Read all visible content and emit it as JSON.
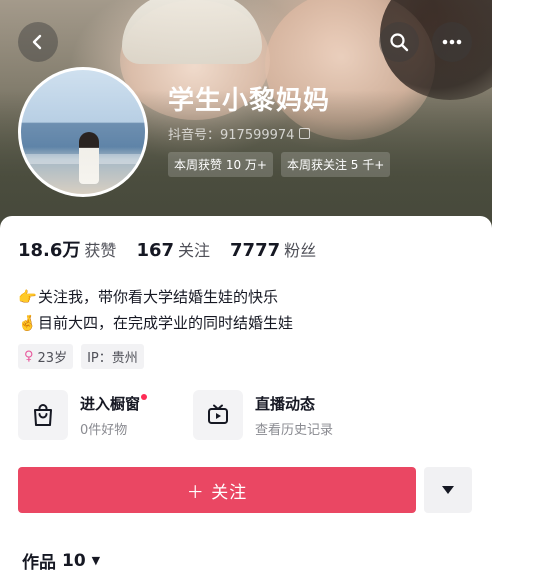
{
  "header": {
    "nickname": "学生小黎妈妈",
    "douyin_id": "抖音号：917599974",
    "week_tags": [
      "本周获赞 10 万+",
      "本周获关注 5 千+"
    ],
    "icons": {
      "back": "back-chevron-icon",
      "search": "search-icon",
      "more": "more-icon",
      "copy": "copy-icon"
    }
  },
  "stats": {
    "likes": {
      "value": "18.6万",
      "label": "获赞"
    },
    "following": {
      "value": "167",
      "label": "关注"
    },
    "followers": {
      "value": "7777",
      "label": "粉丝"
    }
  },
  "bio": {
    "line1": {
      "emoji": "👉",
      "text": "关注我，带你看大学结婚生娃的快乐"
    },
    "line2": {
      "emoji": "🤞",
      "text": "目前大四，在完成学业的同时结婚生娃"
    }
  },
  "meta": {
    "age": "23岁",
    "ip": "IP：贵州"
  },
  "features": {
    "shop": {
      "title": "进入橱窗",
      "subtitle": "0件好物",
      "icon": "shopping-bag-icon",
      "has_red_dot": true
    },
    "live": {
      "title": "直播动态",
      "subtitle": "查看历史记录",
      "icon": "tv-icon"
    }
  },
  "actions": {
    "follow_label": "＋ 关注",
    "accent_color": "#ea4763"
  },
  "tabs": {
    "works_label": "作品",
    "works_count": "10"
  }
}
